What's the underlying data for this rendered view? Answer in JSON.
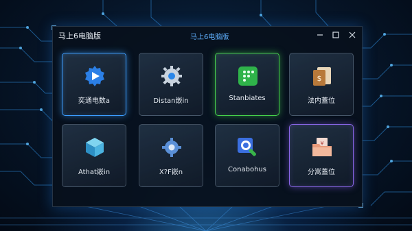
{
  "window": {
    "title": "马上6电脑版",
    "center_title": "马上6电脑版",
    "controls": {
      "minimize": "minimize-icon",
      "maximize": "maximize-icon",
      "close": "close-icon"
    }
  },
  "tiles": [
    {
      "label": "奕通电数a",
      "icon": "play-badge-icon",
      "highlight": "#3c9dff"
    },
    {
      "label": "Distan嵌in",
      "icon": "gear-icon",
      "highlight": ""
    },
    {
      "label": "Stanbiates",
      "icon": "green-app-icon",
      "highlight": "#46d24a"
    },
    {
      "label": "法内蓋位",
      "icon": "document-icon",
      "highlight": ""
    },
    {
      "label": "Athat嵌in",
      "icon": "cube-icon",
      "highlight": ""
    },
    {
      "label": "X?F嵌n",
      "icon": "gear-blue-icon",
      "highlight": ""
    },
    {
      "label": "Conabohus",
      "icon": "search-icon",
      "highlight": ""
    },
    {
      "label": "分嵩蓋位",
      "icon": "folder-icon",
      "highlight": "#8a66e8"
    }
  ]
}
